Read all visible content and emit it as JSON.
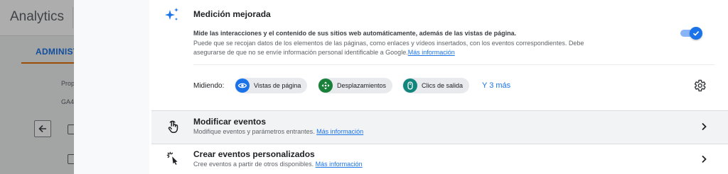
{
  "background": {
    "app_title": "Analytics",
    "active_tab": "ADMINIST",
    "small_label_1": "Prop",
    "small_label_2": "GA4"
  },
  "enhanced_measurement": {
    "title": "Medición mejorada",
    "description_bold": "Mide las interacciones y el contenido de sus sitios web automáticamente, además de las vistas de página.",
    "description_line1": "Puede que se recojan datos de los elementos de las páginas, como enlaces y vídeos insertados, con los eventos correspondientes. Debe",
    "description_line2": "asegurarse de que no se envíe información personal identificable a Google.",
    "learn_more": "Más información",
    "toggle_on": true,
    "measuring_label": "Midiendo:",
    "chips": [
      {
        "label": "Vistas de página",
        "icon": "eye-icon",
        "color": "#1a73e8"
      },
      {
        "label": "Desplazamientos",
        "icon": "crosshair-icon",
        "color": "#188038"
      },
      {
        "label": "Clics de salida",
        "icon": "mouse-icon",
        "color": "#12857d"
      }
    ],
    "more_link": "Y 3 más"
  },
  "rows": [
    {
      "title": "Modificar eventos",
      "subtitle": "Modifique eventos y parámetros entrantes.",
      "link": "Más información",
      "icon": "touch-icon"
    },
    {
      "title": "Crear eventos personalizados",
      "subtitle": "Cree eventos a partir de otros disponibles.",
      "link": "Más información",
      "icon": "click-sparkle-icon"
    }
  ],
  "colors": {
    "accent": "#1a73e8",
    "toggle_track": "#8ab4f8"
  }
}
